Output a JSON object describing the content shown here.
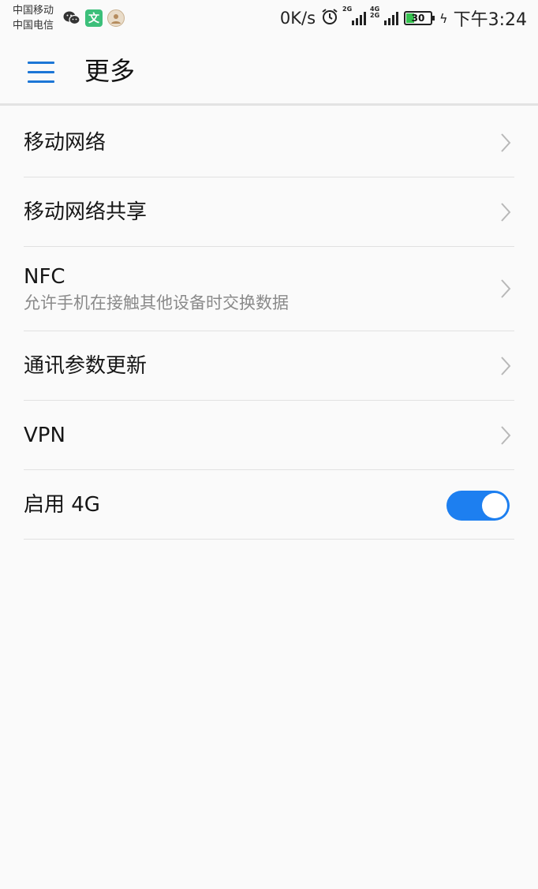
{
  "status_bar": {
    "carrier_1": "中国移动",
    "carrier_2": "中国电信",
    "notification_icons": [
      "wechat-icon",
      "wen-app-icon",
      "avatar-app-icon"
    ],
    "wen_label": "文",
    "net_speed": "0K/s",
    "signal_1_tag": "2G",
    "signal_2_tag": "4G 2G",
    "battery_level": "30",
    "time": "下午3:24"
  },
  "app_bar": {
    "title": "更多",
    "menu_icon": "hamburger-menu-icon"
  },
  "list": {
    "items": [
      {
        "title": "移动网络",
        "subtitle": "",
        "control": "chevron"
      },
      {
        "title": "移动网络共享",
        "subtitle": "",
        "control": "chevron"
      },
      {
        "title": "NFC",
        "subtitle": "允许手机在接触其他设备时交换数据",
        "control": "chevron"
      },
      {
        "title": "通讯参数更新",
        "subtitle": "",
        "control": "chevron"
      },
      {
        "title": "VPN",
        "subtitle": "",
        "control": "chevron"
      },
      {
        "title": "启用 4G",
        "subtitle": "",
        "control": "toggle",
        "toggle_on": true
      }
    ]
  },
  "colors": {
    "accent": "#1d7ff0",
    "menu_icon": "#1c76d6",
    "background": "#fafafa",
    "divider": "#e1e1e1",
    "subtitle": "#8a8a8a"
  }
}
